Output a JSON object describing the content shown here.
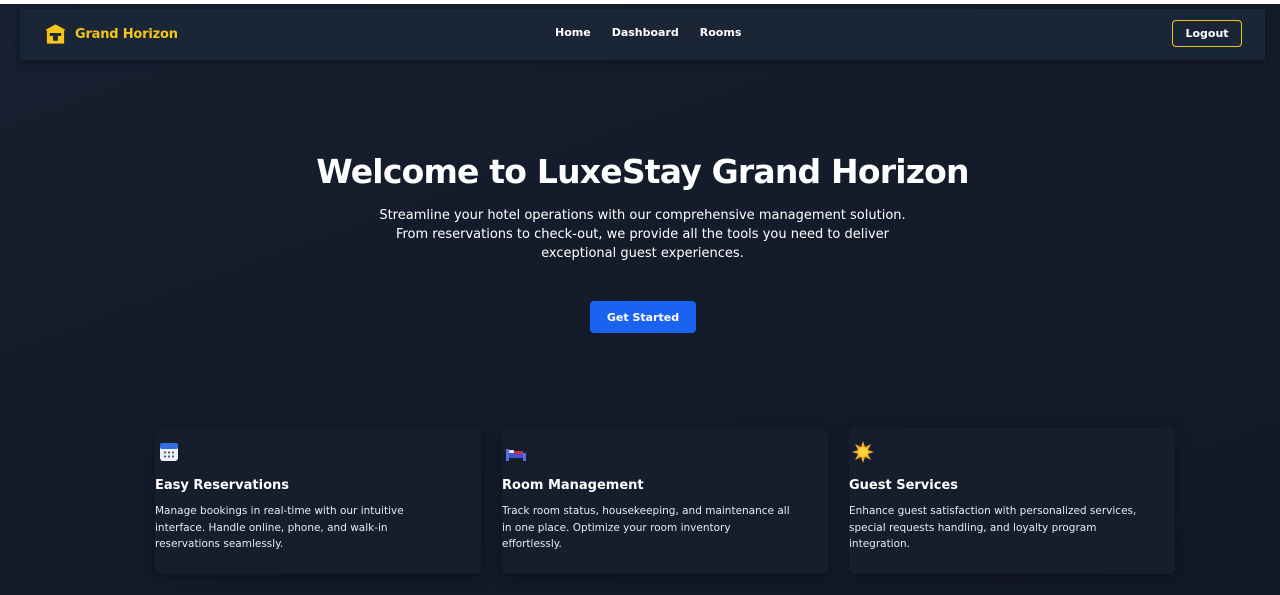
{
  "nav": {
    "brand": "Grand Horizon",
    "links": [
      "Home",
      "Dashboard",
      "Rooms"
    ],
    "logout": "Logout"
  },
  "hero": {
    "title": "Welcome to LuxeStay Grand Horizon",
    "subtitle": "Streamline your hotel operations with our comprehensive management solution. From reservations to check-out, we provide all the tools you need to deliver exceptional guest experiences.",
    "cta": "Get Started"
  },
  "features": [
    {
      "icon": "calendar-icon",
      "title": "Easy Reservations",
      "text": "Manage bookings in real-time with our intuitive interface. Handle online, phone, and walk-in reservations seamlessly."
    },
    {
      "icon": "bed-icon",
      "title": "Room Management",
      "text": "Track room status, housekeeping, and maintenance all in one place. Optimize your room inventory effortlessly."
    },
    {
      "icon": "sun-icon",
      "title": "Guest Services",
      "text": "Enhance guest satisfaction with personalized services, special requests handling, and loyalty program integration."
    }
  ],
  "colors": {
    "background": "#141b2b",
    "navbar": "#1a2536",
    "accent": "#f5c518",
    "primary_button": "#1a62f0"
  }
}
